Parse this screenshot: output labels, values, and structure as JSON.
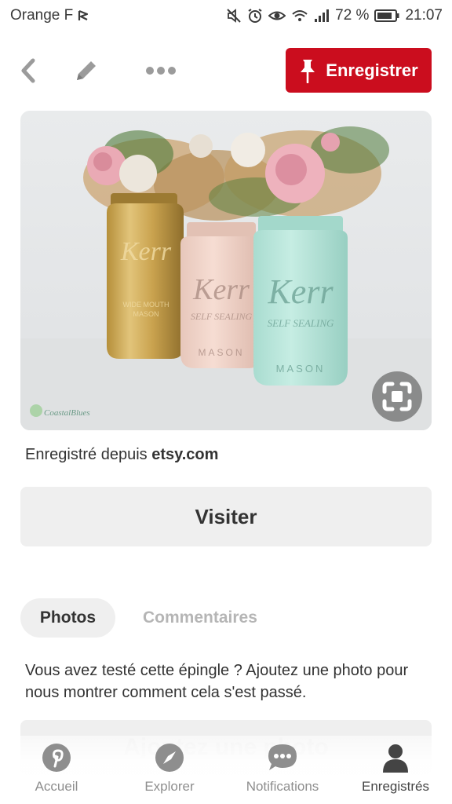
{
  "status_bar": {
    "carrier": "Orange F",
    "battery": "72 %",
    "time": "21:07"
  },
  "toolbar": {
    "save_label": "Enregistrer",
    "icons": [
      "back-arrow",
      "pencil",
      "more-dots",
      "pin"
    ],
    "accent_color": "#cb0d1e"
  },
  "pin": {
    "jar_labels": [
      "Kerr",
      "SELF SEALING",
      "MASON"
    ],
    "watermark": "CoastalBlues"
  },
  "source": {
    "prefix": "Enregistré depuis ",
    "domain": "etsy.com"
  },
  "visit_label": "Visiter",
  "tabs": [
    {
      "label": "Photos",
      "active": true
    },
    {
      "label": "Commentaires",
      "active": false
    }
  ],
  "prompt_text": "Vous avez testé cette épingle ? Ajoutez une photo pour nous montrer comment cela s'est passé.",
  "add_photo_label": "Ajoutez une photo",
  "nav": [
    {
      "label": "Accueil",
      "icon": "pinterest-icon"
    },
    {
      "label": "Explorer",
      "icon": "compass-icon"
    },
    {
      "label": "Notifications",
      "icon": "chat-bubble-icon"
    },
    {
      "label": "Enregistrés",
      "icon": "person-icon",
      "active": true
    }
  ]
}
